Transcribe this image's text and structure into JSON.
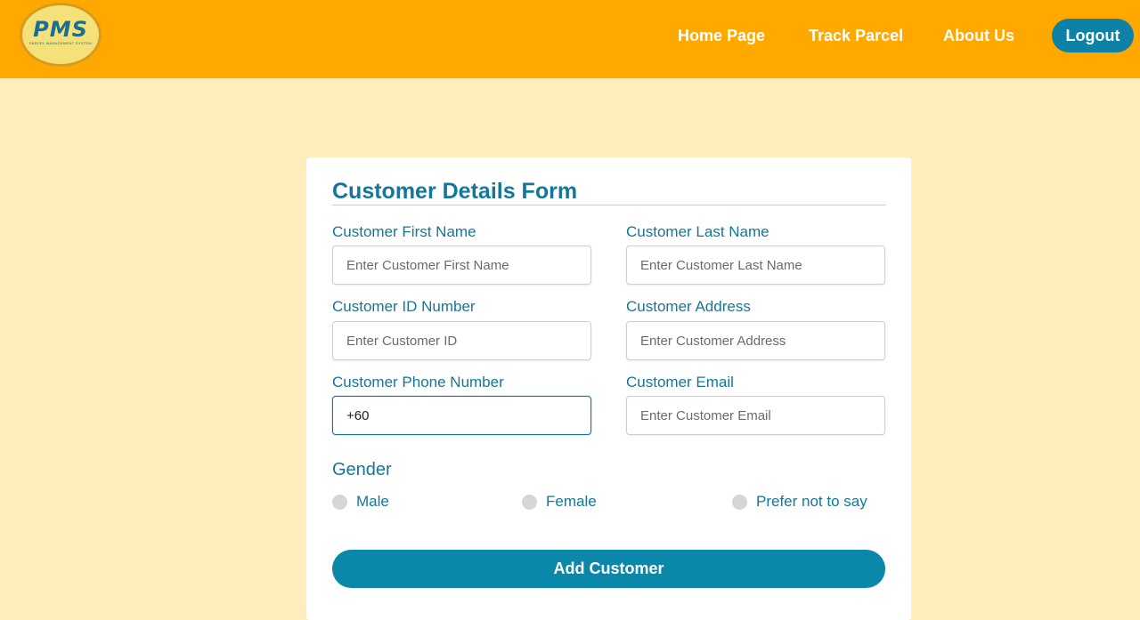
{
  "brand": {
    "logo_text": "PMS",
    "logo_subtext": "Parcel Management System"
  },
  "nav": {
    "home": "Home Page",
    "track": "Track Parcel",
    "about": "About Us",
    "logout": "Logout"
  },
  "form": {
    "title": "Customer Details Form",
    "fields": {
      "first_name": {
        "label": "Customer First Name",
        "placeholder": "Enter Customer First Name",
        "value": ""
      },
      "last_name": {
        "label": "Customer Last Name",
        "placeholder": "Enter Customer Last Name",
        "value": ""
      },
      "id_number": {
        "label": "Customer ID Number",
        "placeholder": "Enter Customer ID",
        "value": ""
      },
      "address": {
        "label": "Customer Address",
        "placeholder": "Enter Customer Address",
        "value": ""
      },
      "phone": {
        "label": "Customer Phone Number",
        "placeholder": "",
        "value": "+60"
      },
      "email": {
        "label": "Customer Email",
        "placeholder": "Enter Customer Email",
        "value": ""
      }
    },
    "gender": {
      "label": "Gender",
      "options": [
        "Male",
        "Female",
        "Prefer not to say"
      ]
    },
    "submit_label": "Add Customer"
  },
  "colors": {
    "navbar": "#ffa800",
    "page_background": "#ffedbb",
    "accent": "#14779a",
    "button": "#0b87aa"
  }
}
